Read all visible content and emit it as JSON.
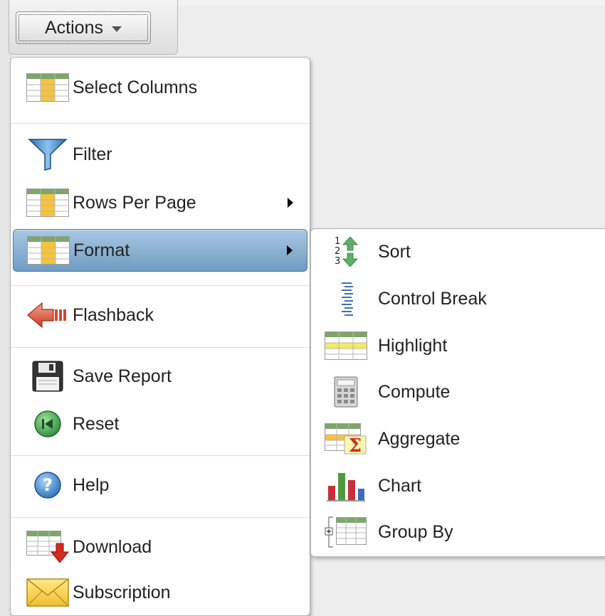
{
  "actions_button": {
    "label": "Actions"
  },
  "menu": {
    "items": [
      {
        "label": "Select Columns",
        "icon": "table-columns-icon"
      },
      {
        "label": "Filter",
        "icon": "funnel-icon"
      },
      {
        "label": "Rows Per Page",
        "icon": "table-rows-icon",
        "has_submenu": true
      },
      {
        "label": "Format",
        "icon": "table-format-icon",
        "has_submenu": true,
        "active": true
      },
      {
        "label": "Flashback",
        "icon": "arrow-left-icon"
      },
      {
        "label": "Save Report",
        "icon": "floppy-disk-icon"
      },
      {
        "label": "Reset",
        "icon": "rewind-icon"
      },
      {
        "label": "Help",
        "icon": "question-icon"
      },
      {
        "label": "Download",
        "icon": "download-icon"
      },
      {
        "label": "Subscription",
        "icon": "envelope-icon"
      }
    ]
  },
  "submenu": {
    "items": [
      {
        "label": "Sort",
        "icon": "sort-icon"
      },
      {
        "label": "Control Break",
        "icon": "control-break-icon"
      },
      {
        "label": "Highlight",
        "icon": "highlight-icon"
      },
      {
        "label": "Compute",
        "icon": "calculator-icon"
      },
      {
        "label": "Aggregate",
        "icon": "sigma-icon"
      },
      {
        "label": "Chart",
        "icon": "bar-chart-icon"
      },
      {
        "label": "Group By",
        "icon": "group-by-icon"
      }
    ]
  },
  "colors": {
    "active_bg_top": "#a9c8e3",
    "active_bg_bottom": "#6f9cc2",
    "table_header": "#7da66b",
    "table_highlight": "#f6c33b"
  }
}
